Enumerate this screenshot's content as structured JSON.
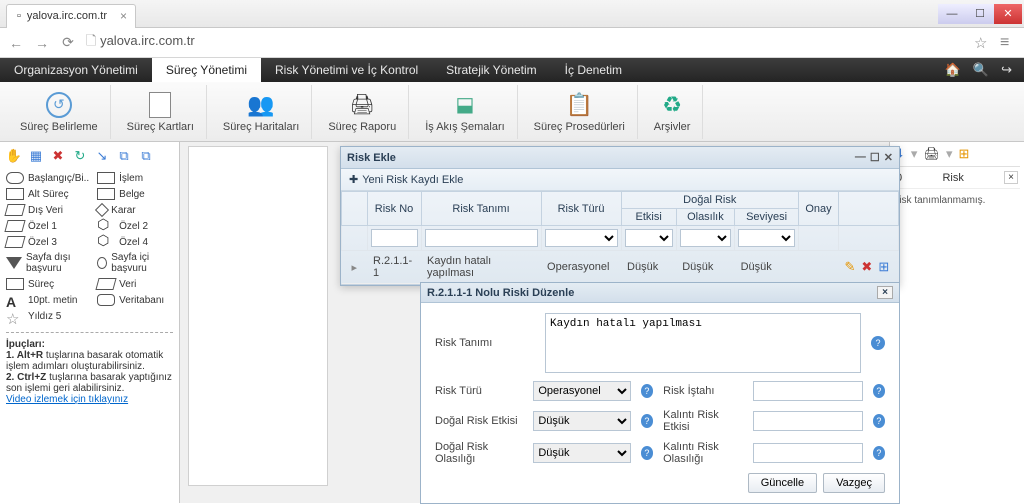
{
  "browser": {
    "tab_title": "yalova.irc.com.tr",
    "url_display": "yalova.irc.com.tr"
  },
  "mainnav": {
    "items": [
      "Organizasyon Yönetimi",
      "Süreç Yönetimi",
      "Risk Yönetimi ve İç Kontrol",
      "Stratejik Yönetim",
      "İç Denetim"
    ],
    "active_index": 1
  },
  "toolbar": {
    "items": [
      {
        "label": "Süreç Belirleme"
      },
      {
        "label": "Süreç Kartları"
      },
      {
        "label": "Süreç Haritaları"
      },
      {
        "label": "Süreç Raporu"
      },
      {
        "label": "İş Akış Şemaları"
      },
      {
        "label": "Süreç Prosedürleri"
      },
      {
        "label": "Arşivler"
      }
    ]
  },
  "palette": {
    "items": [
      [
        "Başlangıç/Bi..",
        "İşlem"
      ],
      [
        "Alt Süreç",
        "Belge"
      ],
      [
        "Dış Veri",
        "Karar"
      ],
      [
        "Özel 1",
        "Özel 2"
      ],
      [
        "Özel 3",
        "Özel 4"
      ],
      [
        "Sayfa dışı başvuru",
        "Sayfa içi başvuru"
      ],
      [
        "Süreç",
        "Veri"
      ],
      [
        "10pt. metin",
        "Veritabanı"
      ],
      [
        "Yıldız 5",
        ""
      ]
    ]
  },
  "tips": {
    "heading": "İpuçları:",
    "l1_bold": "1. Alt+R",
    "l1_rest": " tuşlarına basarak otomatik işlem adımları oluşturabilirsiniz.",
    "l2_bold": "2. Ctrl+Z",
    "l2_rest": " tuşlarına basarak yaptığınız son işlemi geri alabilirsiniz.",
    "video_link": "Video izlemek için tıklayınız"
  },
  "panel": {
    "title": "Risk Ekle",
    "add_label": "Yeni Risk Kaydı Ekle",
    "headers": {
      "risk_no": "Risk No",
      "risk_tanimi": "Risk Tanımı",
      "risk_turu": "Risk Türü",
      "dogal_risk": "Doğal Risk",
      "etkisi": "Etkisi",
      "olasilik": "Olasılık",
      "seviyesi": "Seviyesi",
      "onay": "Onay"
    },
    "row": {
      "no": "R.2.1.1-1",
      "tanim": "Kaydın hatalı yapılması",
      "tur": "Operasyonel",
      "etki": "Düşük",
      "olasilik": "Düşük",
      "seviye": "Düşük"
    }
  },
  "editdlg": {
    "title": "R.2.1.1-1 Nolu Riski Düzenle",
    "labels": {
      "risk_tanimi": "Risk Tanımı",
      "risk_turu": "Risk Türü",
      "risk_istahi": "Risk İştahı",
      "dogal_etki": "Doğal Risk Etkisi",
      "kalinti_etki": "Kalıntı Risk Etkisi",
      "dogal_olasilik": "Doğal Risk Olasılığı",
      "kalinti_olasilik": "Kalıntı Risk Olasılığı"
    },
    "values": {
      "tanim": "Kaydın hatalı yapılması",
      "tur": "Operasyonel",
      "dogal_etki": "Düşük",
      "dogal_olasilik": "Düşük",
      "risk_istahi": "",
      "kalinti_etki": "",
      "kalinti_olasilik": ""
    },
    "buttons": {
      "guncelle": "Güncelle",
      "vazgec": "Vazgeç"
    }
  },
  "rightpane": {
    "count": "0",
    "label": "Risk",
    "msg": "risk tanımlanmamış."
  }
}
